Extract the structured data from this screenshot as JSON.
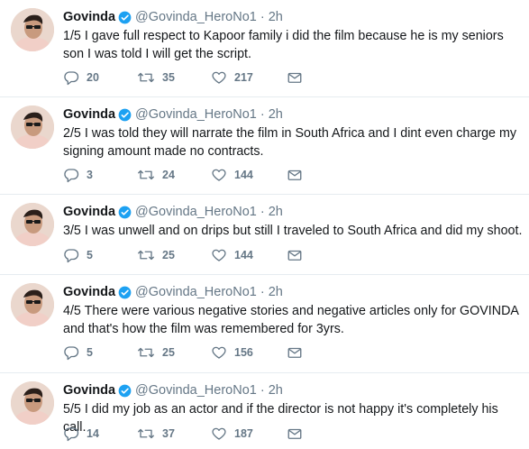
{
  "author": {
    "name": "Govinda",
    "handle": "@Govinda_HeroNo1",
    "verified": true,
    "verified_color": "#1da1f2"
  },
  "tweets": [
    {
      "time": "2h",
      "text": "1/5 I gave full respect to Kapoor family i did the film because he is my seniors son I was told I will get the script.",
      "replies": "20",
      "retweets": "35",
      "likes": "217"
    },
    {
      "time": "2h",
      "text": "2/5 I was told they will narrate the film in South Africa and I dint even charge my signing amount made no contracts.",
      "replies": "3",
      "retweets": "24",
      "likes": "144"
    },
    {
      "time": "2h",
      "text": "3/5 I was unwell and on drips but still I traveled to South Africa and did my shoot.",
      "replies": "5",
      "retweets": "25",
      "likes": "144"
    },
    {
      "time": "2h",
      "text": "4/5  There were various negative stories and negative articles only for GOVINDA and that's how the film was remembered for 3yrs.",
      "replies": "5",
      "retweets": "25",
      "likes": "156"
    },
    {
      "time": "2h",
      "text": "5/5 I did my job as an actor and if the director is not happy it's completely his call.",
      "replies": "14",
      "retweets": "37",
      "likes": "187"
    }
  ],
  "icons": {
    "reply": "reply-icon",
    "retweet": "retweet-icon",
    "like": "heart-icon",
    "dm": "envelope-icon"
  },
  "colors": {
    "text": "#14171a",
    "secondary": "#657786",
    "divider": "#e6ecf0"
  }
}
